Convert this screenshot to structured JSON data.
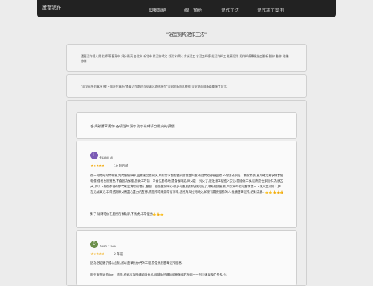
{
  "nav": {
    "brand": "蘆葦泥作",
    "links": [
      "與我聯絡",
      "線上預約",
      "泥作工法",
      "泥作施工案例"
    ]
  },
  "page_title": "\"浴室廁所泥作工法\"",
  "keywords_panel": "蘆葦泥作鐵人鋼 找師傅 舊實中 評分最高 台北市 新北市 找泥作師父 找泥水師父 找水泥工 水泥工師傅 找泥作師工 推薦泥作 泥作師傅專業施工翻新 翻修 整修 修繕 修補",
  "quote_panel": "\"浴室廁所的漏水?樓下鄰居在漏水?蘆葦泥作處理浴室漏水師傅施作\"浴室地板防水層作,浴室壁面翻新兩種施工方式。",
  "reviews_header": "客戶對蘆葦泥作 各項浴缸漏水防水磁磚評分最高的評價",
  "reviews": [
    {
      "author": "Huang Ai",
      "stars": "★★★★★",
      "rating": 5,
      "count": "10 個月前",
      "paragraphs": [
        "從一開始的詢問報價,到問價值細節,回覆速度也很快,所有需求都能儘早處理並好處,有疑問也都直回覆,不會因為與是工務很緊張,直到確定要求做才會報價,價格也很實惠,不會因為加價,施做工的前一天會先看場地,還會復確認,師父是一對父子,很注意工程進入安心,開施做工後,因為是住家施作,為顧五天,所以下班後都會有你們確定清理的地方,整個工程感覺很細心,很多完整,提供的就完成了,聯絡規劃直接,師父平時也完整休息一下就又立刻開工,算在光絨高光,非常感謝師父們盡心盡力的整修,而施作環境非常有效率,這裡真與找到師父,如果有需要服務的人,推薦蘆葦泥作,絕對滿意...👍👍👍👍👍",
        "對了,磁磚可依在處裡的後點淨,不馬虎,非常優秀👍👍👍"
      ]
    },
    {
      "author": "Demi Chen",
      "stars": "★★★★★",
      "rating": 5,
      "count": "2 年前",
      "paragraphs": [
        "因為浴缸變了擔心危險,所以蘆葦找你們的工程,於是找到蘆葦泥作服務。",
        "剛在家先透過line上諮詢,將幾次與照細師傅分析,師傅做好細的部要施作的項目一一列出來與我們參考,也"
      ]
    }
  ],
  "colors": {
    "navbar": "#222222",
    "star": "#f2b01e",
    "avatar1": "#7b5bb5",
    "avatar2": "#6c8f4a"
  }
}
